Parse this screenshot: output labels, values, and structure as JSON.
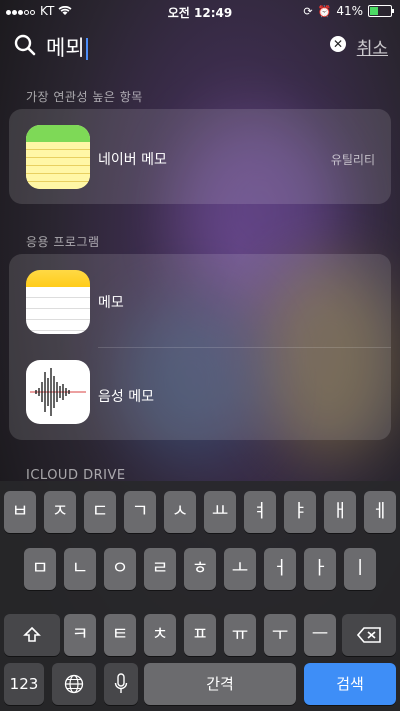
{
  "status_bar": {
    "carrier": "KT",
    "time": "오전 12:49",
    "battery": "41%",
    "battery_level": 0.41
  },
  "search": {
    "query": "메뫼",
    "cancel_label": "취소",
    "clear_icon": "clear-icon",
    "search_icon": "magnifier-icon"
  },
  "sections": {
    "top_hit": "가장 연관성 높은 항목",
    "apps": "응용 프로그램",
    "icloud": "ICLOUD DRIVE"
  },
  "top_hit": {
    "label": "네이버 메모",
    "category": "유틸리티"
  },
  "apps": [
    {
      "label": "메모"
    },
    {
      "label": "음성 메모"
    }
  ],
  "keyboard": {
    "row1": [
      "ㅂ",
      "ㅈ",
      "ㄷ",
      "ㄱ",
      "ㅅ",
      "ㅛ",
      "ㅕ",
      "ㅑ",
      "ㅐ",
      "ㅔ"
    ],
    "row2": [
      "ㅁ",
      "ㄴ",
      "ㅇ",
      "ㄹ",
      "ㅎ",
      "ㅗ",
      "ㅓ",
      "ㅏ",
      "ㅣ"
    ],
    "row3": [
      "ㅋ",
      "ㅌ",
      "ㅊ",
      "ㅍ",
      "ㅠ",
      "ㅜ",
      "ㅡ"
    ],
    "numbers_label": "123",
    "space_label": "간격",
    "search_label": "검색"
  },
  "colors": {
    "accent": "#3e8ef7",
    "battery": "#4cd964"
  }
}
